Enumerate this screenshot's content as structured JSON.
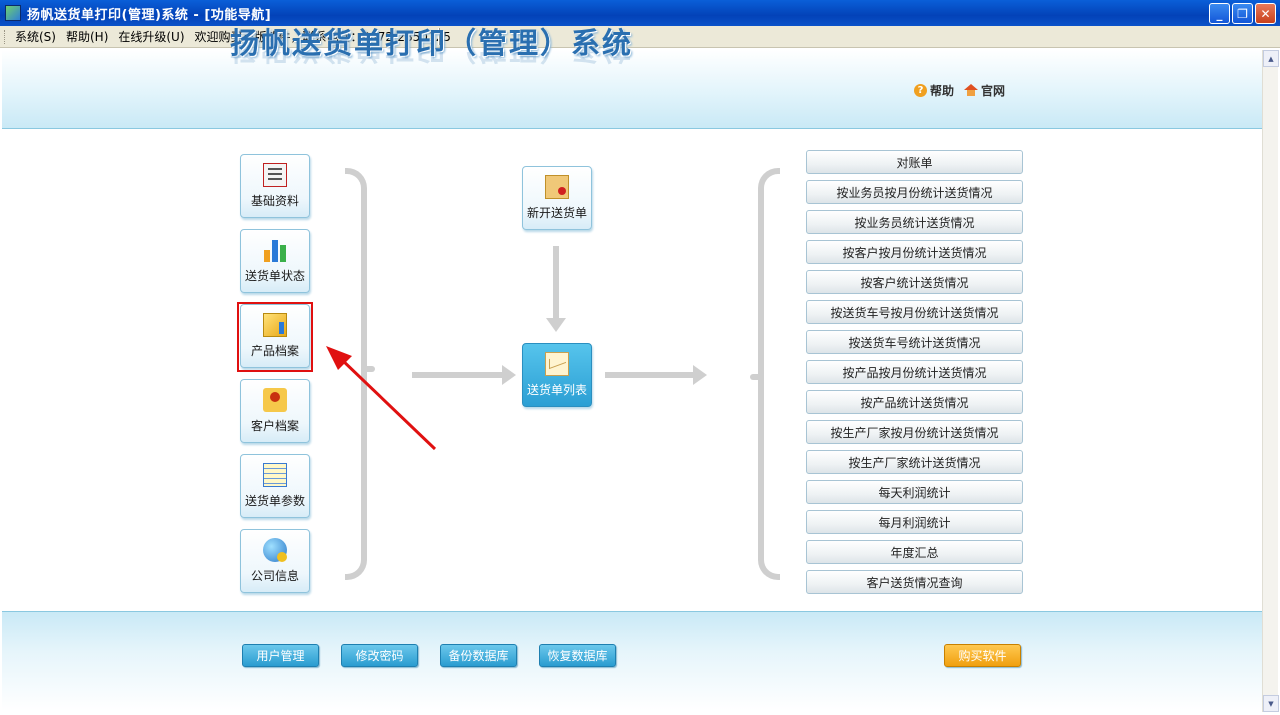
{
  "window": {
    "title": "扬帆送货单打印(管理)系统 - [功能导航]",
    "buttons": {
      "minimize": "_",
      "maximize": "❐",
      "close": "✕"
    }
  },
  "menubar": {
    "items": [
      "系统(S)",
      "帮助(H)",
      "在线升级(U)",
      "欢迎购买正版软件，联系电话：0472-2850125"
    ]
  },
  "header": {
    "logo_text": "扬帆送货单打印（管理）系统",
    "help_label": "帮助",
    "site_label": "官网"
  },
  "left_tiles": [
    {
      "label": "基础资料",
      "icon": "list-icon"
    },
    {
      "label": "送货单状态",
      "icon": "bar-chart-icon"
    },
    {
      "label": "产品档案",
      "icon": "product-icon"
    },
    {
      "label": "客户档案",
      "icon": "customer-icon"
    },
    {
      "label": "送货单参数",
      "icon": "notepad-icon"
    },
    {
      "label": "公司信息",
      "icon": "company-icon"
    }
  ],
  "center_tiles": {
    "new_delivery": {
      "label": "新开送货单",
      "icon": "new-document-icon"
    },
    "delivery_list": {
      "label": "送货单列表",
      "icon": "envelope-icon"
    }
  },
  "reports": [
    "对账单",
    "按业务员按月份统计送货情况",
    "按业务员统计送货情况",
    "按客户按月份统计送货情况",
    "按客户统计送货情况",
    "按送货车号按月份统计送货情况",
    "按送货车号统计送货情况",
    "按产品按月份统计送货情况",
    "按产品统计送货情况",
    "按生产厂家按月份统计送货情况",
    "按生产厂家统计送货情况",
    "每天利润统计",
    "每月利润统计",
    "年度汇总",
    "客户送货情况查询"
  ],
  "footer": {
    "user_mgmt": "用户管理",
    "change_pwd": "修改密码",
    "backup_db": "备份数据库",
    "restore_db": "恢复数据库",
    "buy": "购买软件"
  },
  "colors": {
    "accent": "#2a9cd0",
    "highlight": "#e01010",
    "buy": "#f0a010"
  }
}
